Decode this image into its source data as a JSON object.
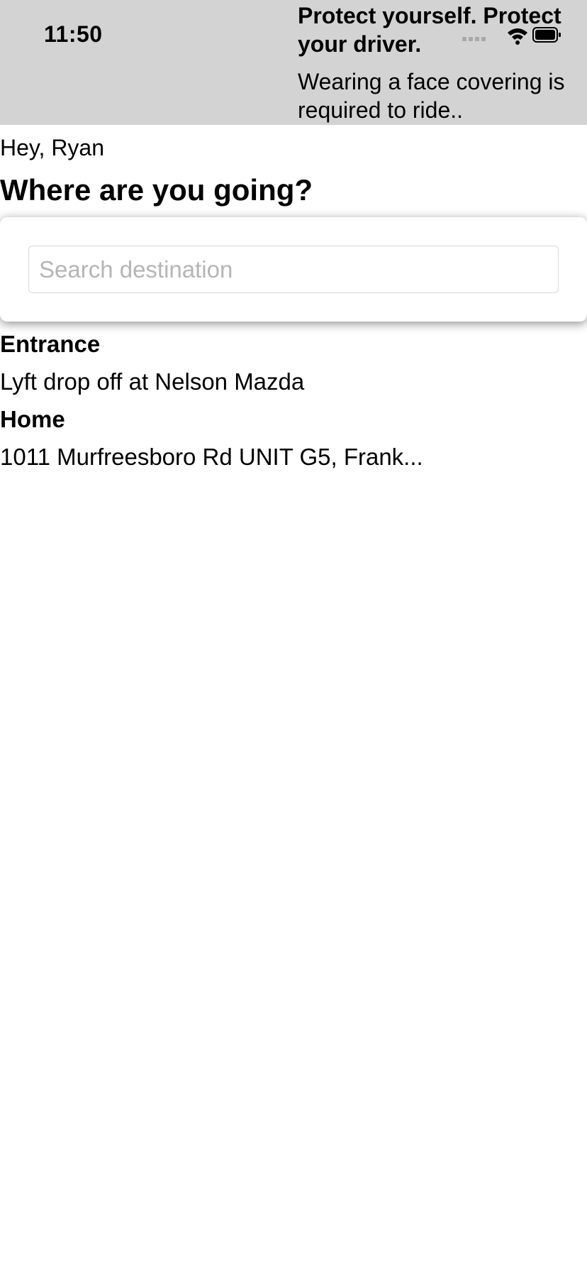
{
  "status_bar": {
    "time": "11:50",
    "icons": [
      "signal-icon",
      "wifi-icon",
      "battery-icon"
    ]
  },
  "banner": {
    "title": "Protect yourself. Protect your driver.",
    "message": "Wearing a face covering is required to ride..",
    "background": "#d3d3d3"
  },
  "greeting": "Hey, Ryan",
  "heading": "Where are you going?",
  "search": {
    "placeholder": "Search destination",
    "value": ""
  },
  "saved_places": [
    {
      "label": "Entrance",
      "address": "Lyft drop off at Nelson Mazda"
    },
    {
      "label": "Home",
      "address": "1011 Murfreesboro Rd UNIT G5, Frank..."
    }
  ]
}
